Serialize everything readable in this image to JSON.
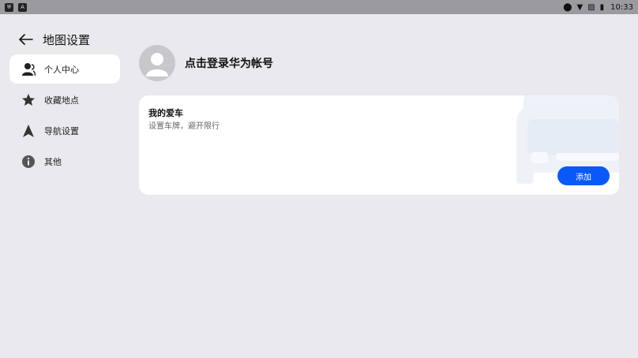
{
  "status_bar": {
    "time": "10:33",
    "left_icons": [
      "shield-icon",
      "a-icon"
    ],
    "right_icons": [
      "location-icon",
      "wifi-icon",
      "sim-icon",
      "battery-icon"
    ]
  },
  "header": {
    "title": "地图设置"
  },
  "sidebar": {
    "items": [
      {
        "label": "个人中心",
        "icon": "person-icon",
        "active": true
      },
      {
        "label": "收藏地点",
        "icon": "star-icon",
        "active": false
      },
      {
        "label": "导航设置",
        "icon": "navigation-arrow-icon",
        "active": false
      },
      {
        "label": "其他",
        "icon": "info-icon",
        "active": false
      }
    ]
  },
  "profile": {
    "login_text": "点击登录华为帐号"
  },
  "car_card": {
    "title": "我的爱车",
    "subtitle": "设置车牌，避开限行",
    "add_label": "添加"
  },
  "colors": {
    "accent": "#0a59f7",
    "background": "#e9e9ee",
    "card": "#ffffff"
  }
}
